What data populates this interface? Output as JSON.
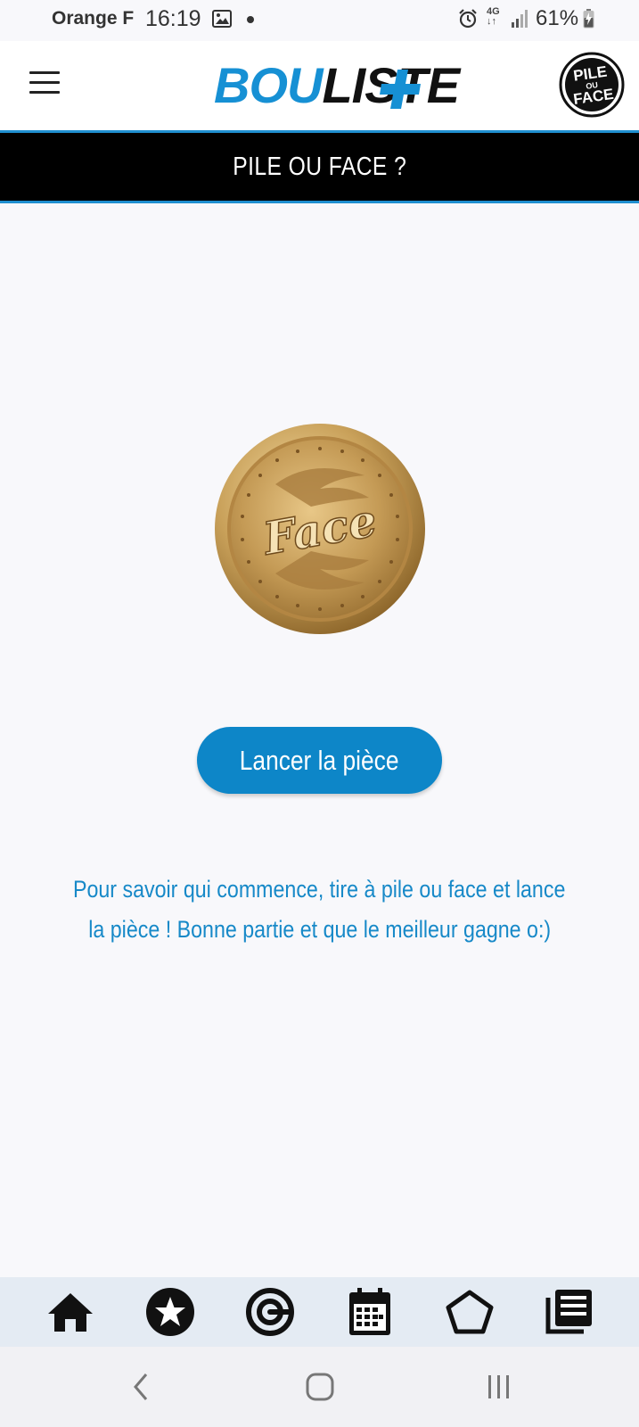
{
  "status_bar": {
    "carrier": "Orange F",
    "time": "16:19",
    "network": "4G",
    "battery": "61%"
  },
  "app_bar": {
    "logo_part1": "BOU",
    "logo_part2": "LISTE",
    "badge_text": "PILE OU FACE"
  },
  "page": {
    "title": "PILE OU FACE ?",
    "coin_face": "Face",
    "toss_button": "Lancer la pièce",
    "info_line1": "Pour savoir qui commence, tire à pile ou face et lance",
    "info_line2": "la pièce ! Bonne partie et que le meilleur gagne o:)"
  },
  "bottom_nav": [
    "home-icon",
    "star-icon",
    "target-icon",
    "calendar-icon",
    "pentagon-icon",
    "news-icon"
  ],
  "colors": {
    "accent": "#0d86c8",
    "text_blue": "#1789c8",
    "title_bar": "#000000",
    "coin_gold": "#c9a15a"
  }
}
